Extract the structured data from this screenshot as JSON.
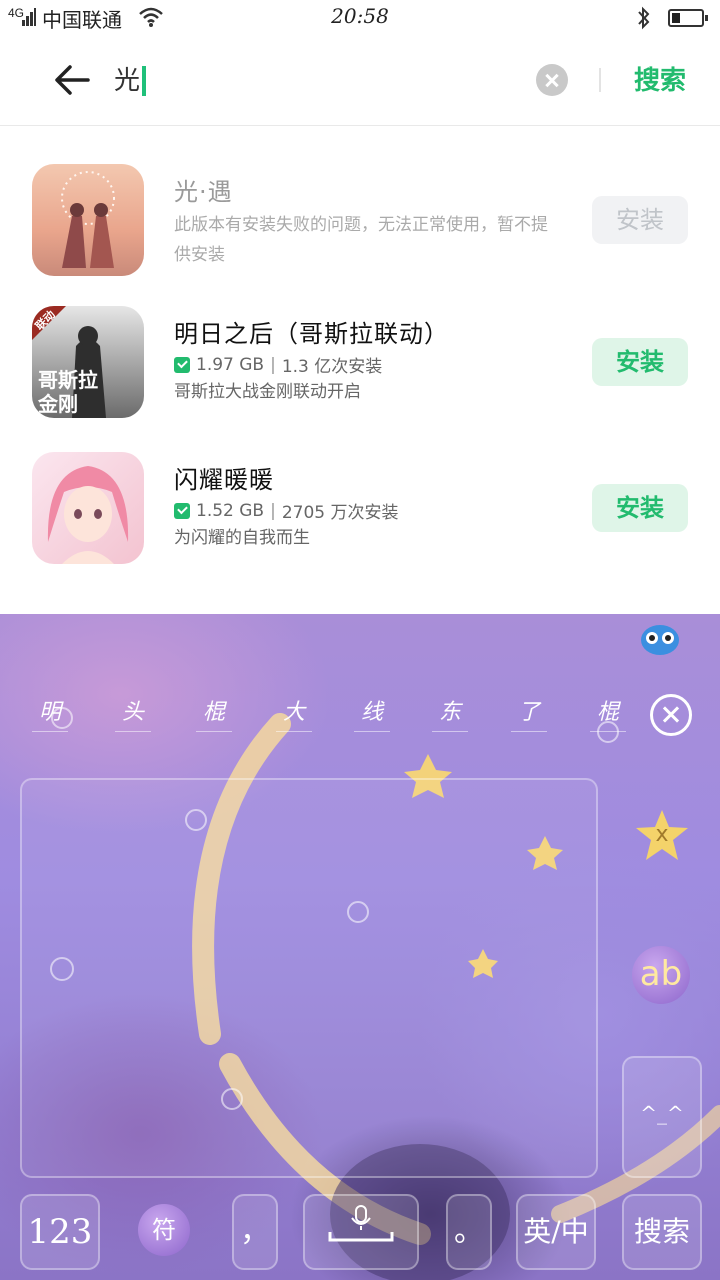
{
  "status_bar": {
    "network": "4G",
    "carrier": "中国联通",
    "time": "20:58",
    "battery_level": 0.3
  },
  "search": {
    "query": "光",
    "search_label": "搜索"
  },
  "results": [
    {
      "name": "光·遇",
      "note": "此版本有安装失败的问题，无法正常使用，暂不提供安装",
      "install_label": "安装",
      "enabled": false
    },
    {
      "name": "明日之后（哥斯拉联动）",
      "size": "1.97 GB",
      "installs": "1.3 亿次安装",
      "desc": "哥斯拉大战金刚联动开启",
      "icon_badge": "联动",
      "icon_text_1": "哥斯拉",
      "icon_text_2": "金刚",
      "install_label": "安装",
      "enabled": true
    },
    {
      "name": "闪耀暖暖",
      "size": "1.52 GB",
      "installs": "2705 万次安装",
      "desc": "为闪耀的自我而生",
      "install_label": "安装",
      "enabled": true
    }
  ],
  "keyboard": {
    "candidates": [
      "明",
      "头",
      "棍",
      "大",
      "线",
      "东",
      "了",
      "棍"
    ],
    "side_ab": "ab",
    "side_star": "x",
    "keys": {
      "num": "123",
      "sym": "符",
      "comma": "，",
      "period": "。",
      "lang": "英/中",
      "search": "搜索"
    }
  },
  "colors": {
    "accent": "#22bb6e",
    "keyboard_bg": "#9f8ce0"
  }
}
